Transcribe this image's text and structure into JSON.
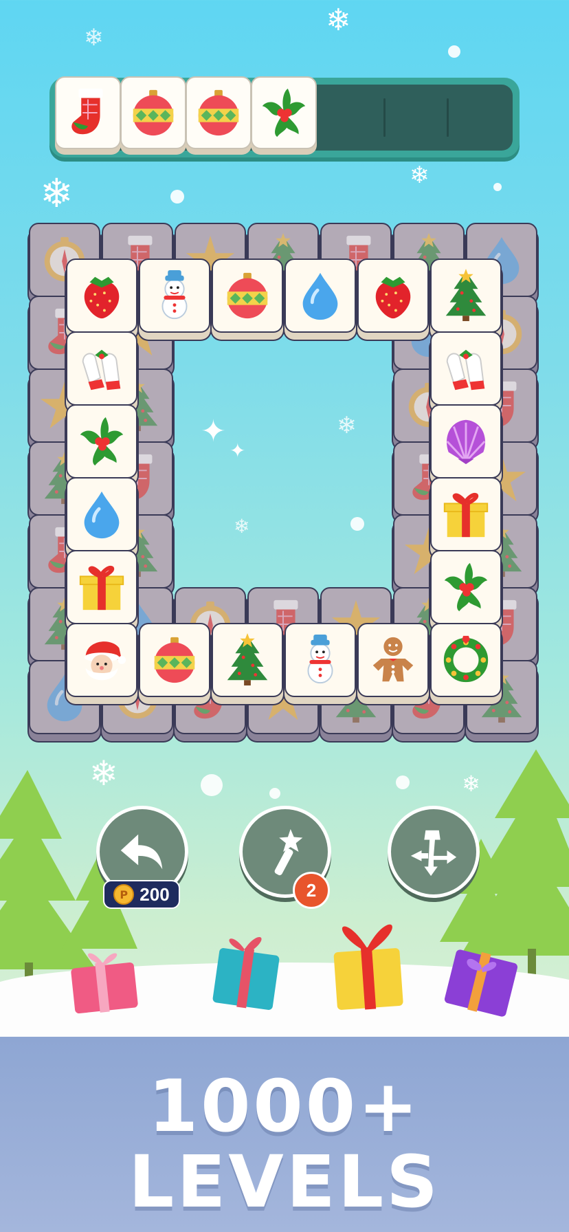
{
  "tray": {
    "capacity": 7,
    "items": [
      "stocking-icon",
      "ornament-icon",
      "ornament-icon",
      "holly-icon"
    ]
  },
  "board": {
    "back_row_icons": [
      "compass-icon",
      "stocking-icon",
      "star-icon",
      "tree-icon",
      "stocking-icon",
      "tree-icon",
      "drop-icon"
    ],
    "top_row": [
      "strawberry-icon",
      "snowman-icon",
      "ornament-icon",
      "drop-icon",
      "strawberry-icon",
      "tree-icon"
    ],
    "left_column": [
      "mittens-icon",
      "holly-icon",
      "drop-icon",
      "gift-icon"
    ],
    "right_column": [
      "mittens-icon",
      "shell-icon",
      "gift-icon",
      "holly-icon"
    ],
    "bottom_row": [
      "santa-icon",
      "ornament-icon",
      "tree-icon",
      "snowman-icon",
      "gingerbread-icon",
      "wreath-icon"
    ]
  },
  "tools": {
    "undo": {
      "icon": "undo-arrow-icon",
      "cost": "200"
    },
    "hint": {
      "icon": "magic-wand-icon",
      "count": "2"
    },
    "shuffle": {
      "icon": "shuffle-icon"
    }
  },
  "banner": {
    "line1": "1000+",
    "line2": "LEVELS"
  },
  "colors": {
    "sky_top": "#5fd6f2",
    "tray": "#3aa69a",
    "tool_button": "#6e8a7a",
    "banner": "#9aaed8"
  }
}
